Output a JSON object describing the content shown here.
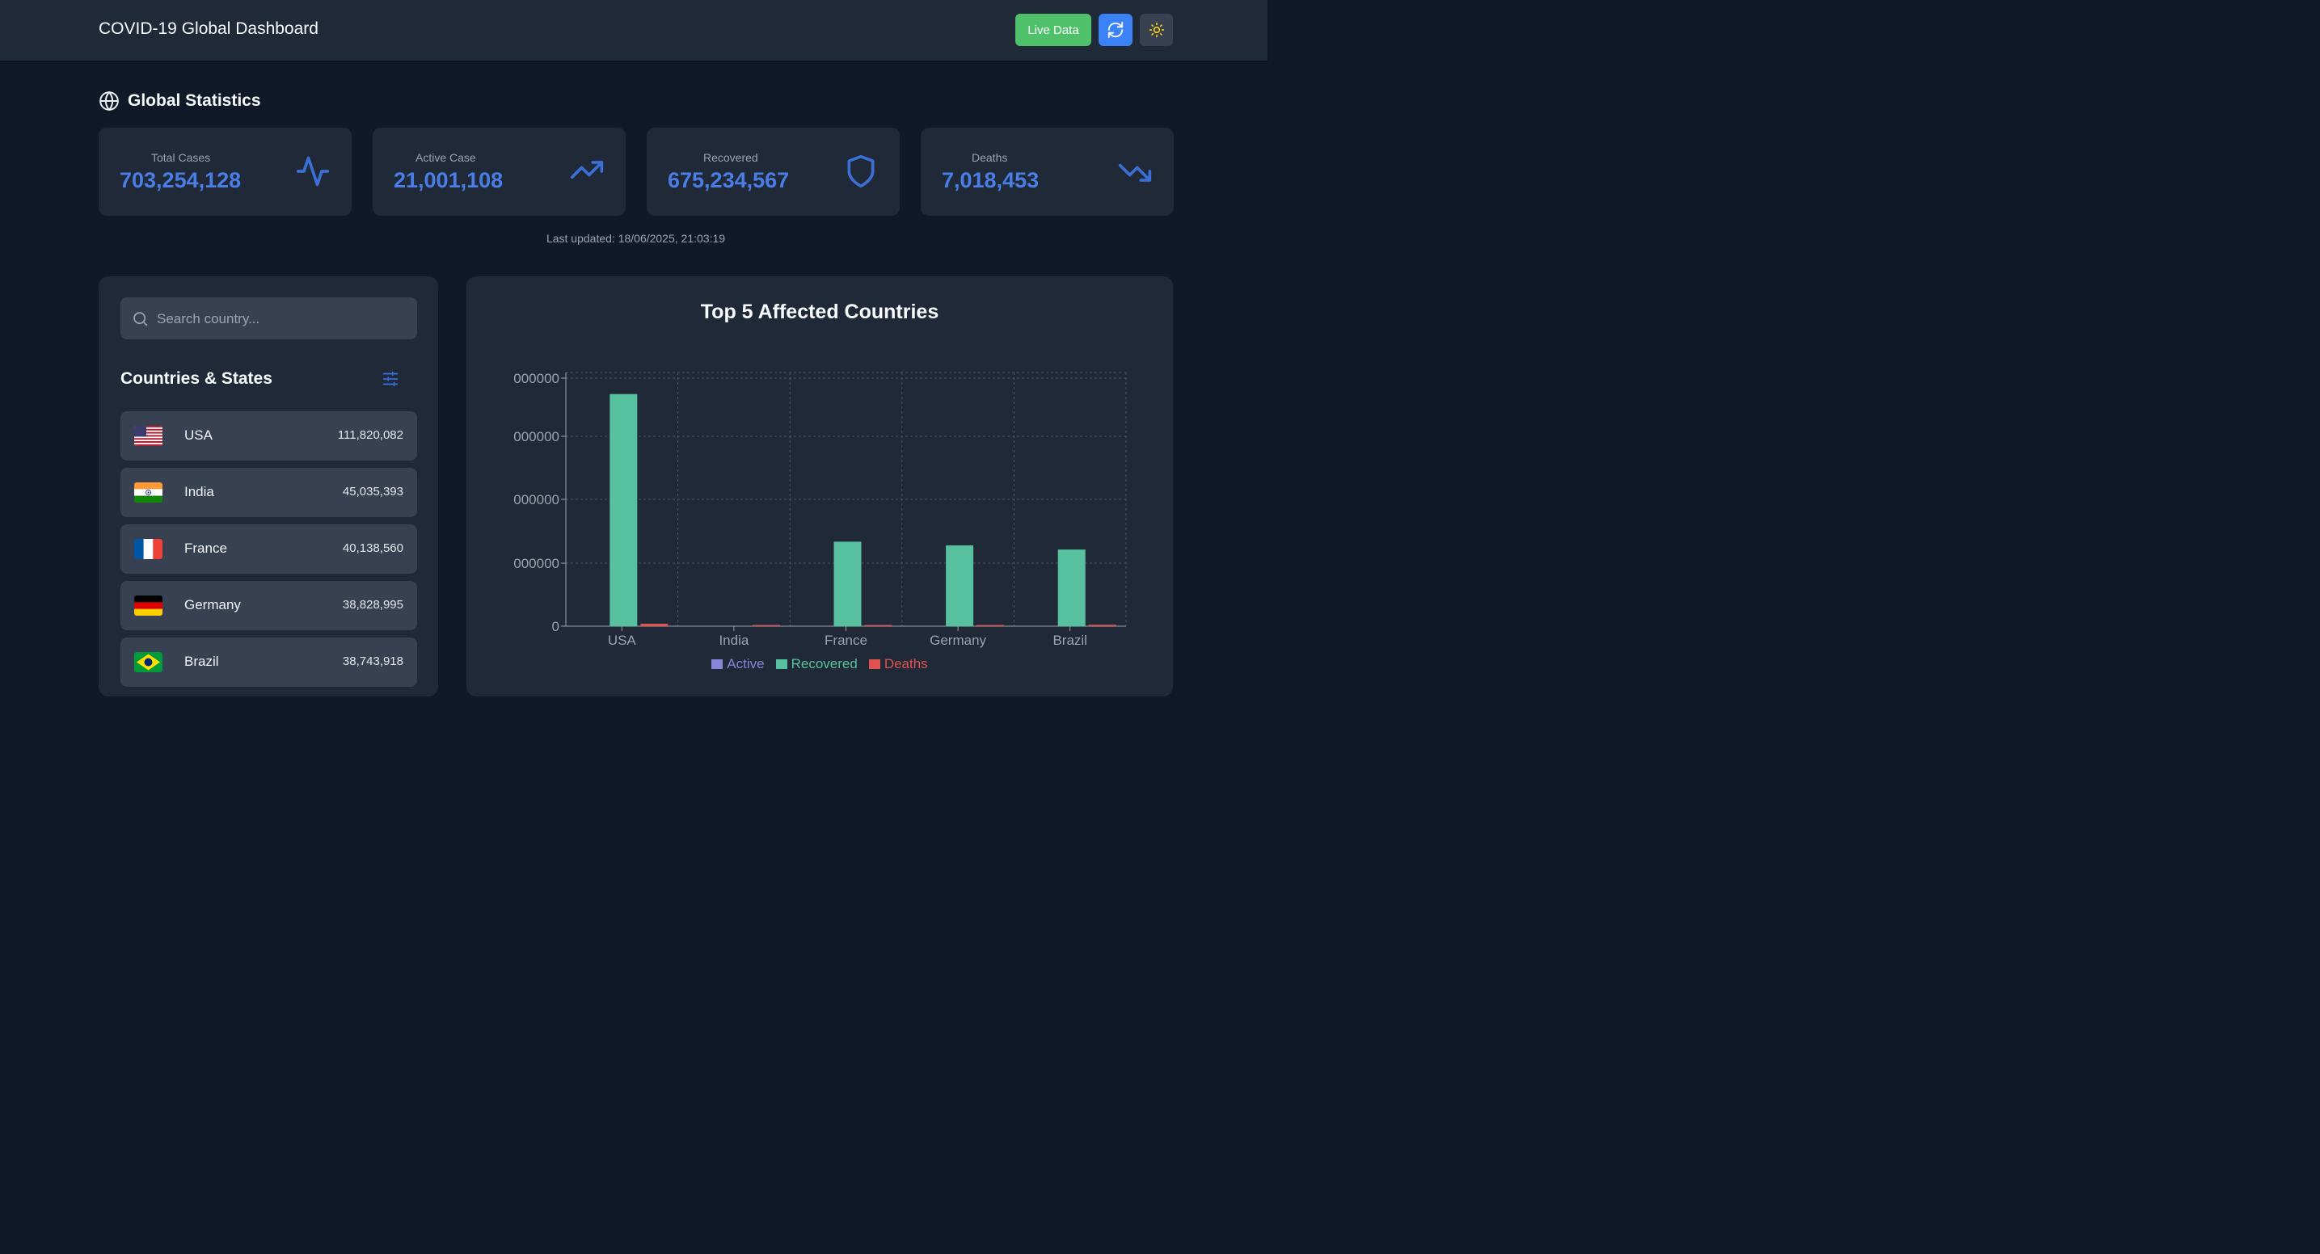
{
  "header": {
    "title": "COVID-19 Global Dashboard",
    "live_label": "Live Data",
    "refresh_icon": "refresh-icon",
    "theme_icon": "sun-icon"
  },
  "global": {
    "title": "Global Statistics",
    "cards": [
      {
        "label": "Total Cases",
        "value": "703,254,128",
        "icon": "activity-icon"
      },
      {
        "label": "Active Case",
        "value": "21,001,108",
        "icon": "trending-up-icon"
      },
      {
        "label": "Recovered",
        "value": "675,234,567",
        "icon": "shield-icon"
      },
      {
        "label": "Deaths",
        "value": "7,018,453",
        "icon": "trending-down-icon"
      }
    ],
    "updated": "Last updated: 18/06/2025, 21:03:19"
  },
  "sidebar": {
    "search_placeholder": "Search country...",
    "title": "Countries & States",
    "countries": [
      {
        "name": "USA",
        "count": "111,820,082",
        "flag": "us-flag"
      },
      {
        "name": "India",
        "count": "45,035,393",
        "flag": "india-flag"
      },
      {
        "name": "France",
        "count": "40,138,560",
        "flag": "france-flag"
      },
      {
        "name": "Germany",
        "count": "38,828,995",
        "flag": "germany-flag"
      },
      {
        "name": "Brazil",
        "count": "38,743,918",
        "flag": "brazil-flag"
      }
    ]
  },
  "colors": {
    "active": "#8884d8",
    "recovered": "#57c19f",
    "deaths": "#e0524f",
    "accent": "#4a7de6"
  },
  "chart_data": {
    "type": "bar",
    "title": "Top 5 Affected Countries",
    "categories": [
      "USA",
      "India",
      "France",
      "Germany",
      "Brazil"
    ],
    "y_ticks": [
      "0",
      "000000",
      "000000",
      "000000",
      "000000"
    ],
    "ylim": [
      0,
      120000000
    ],
    "grid": true,
    "legend_position": "bottom",
    "series": [
      {
        "name": "Active",
        "values": [
          0,
          0,
          0,
          0,
          0
        ]
      },
      {
        "name": "Recovered",
        "values": [
          109800000,
          0,
          39970000,
          38240000,
          36250000
        ]
      },
      {
        "name": "Deaths",
        "values": [
          1190000,
          530000,
          170000,
          180000,
          700000
        ]
      }
    ]
  }
}
